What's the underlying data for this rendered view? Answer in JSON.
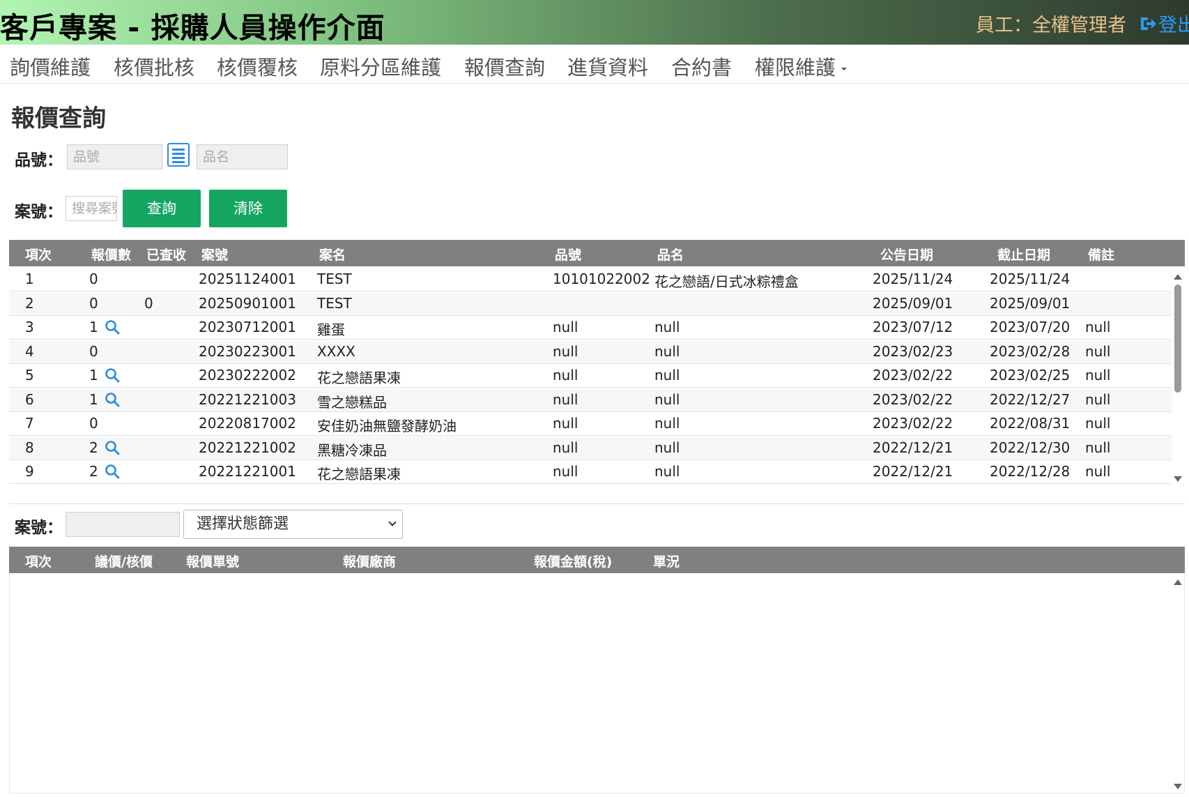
{
  "header": {
    "title": "客戶專案 - 採購人員操作介面",
    "user": "員工：全權管理者",
    "logout_label": "登出"
  },
  "nav": {
    "items": [
      "詢價維護",
      "核價批核",
      "核價覆核",
      "原料分區維護",
      "報價查詢",
      "進貨資料",
      "合約書",
      "權限維護"
    ]
  },
  "page": {
    "title": "報價查詢"
  },
  "search": {
    "part_label": "品號：",
    "part_placeholder": "品號",
    "name_placeholder": "品名",
    "case_label": "案號：",
    "case_placeholder": "搜尋案號",
    "query_button": "查詢",
    "clear_button": "清除"
  },
  "quote_table": {
    "headers": [
      "項次",
      "報價數",
      "已查收",
      "案號",
      "案名",
      "品號",
      "品名",
      "公告日期",
      "截止日期",
      "備註"
    ],
    "rows": [
      {
        "no": "1",
        "count": "0",
        "viewed": "",
        "case": "20251124001",
        "name": "TEST",
        "part": "10101022002",
        "pname": "花之戀語/日式冰粽禮盒",
        "pub": "2025/11/24",
        "due": "2025/11/24",
        "note": "",
        "search": false
      },
      {
        "no": "2",
        "count": "0",
        "viewed": "0",
        "case": "20250901001",
        "name": "TEST",
        "part": "",
        "pname": "",
        "pub": "2025/09/01",
        "due": "2025/09/01",
        "note": "",
        "search": false
      },
      {
        "no": "3",
        "count": "1",
        "viewed": "",
        "case": "20230712001",
        "name": "雞蛋",
        "part": "null",
        "pname": "null",
        "pub": "2023/07/12",
        "due": "2023/07/20",
        "note": "null",
        "search": true
      },
      {
        "no": "4",
        "count": "0",
        "viewed": "",
        "case": "20230223001",
        "name": "XXXX",
        "part": "null",
        "pname": "null",
        "pub": "2023/02/23",
        "due": "2023/02/28",
        "note": "null",
        "search": false
      },
      {
        "no": "5",
        "count": "1",
        "viewed": "",
        "case": "20230222002",
        "name": "花之戀語果凍",
        "part": "null",
        "pname": "null",
        "pub": "2023/02/22",
        "due": "2023/02/25",
        "note": "null",
        "search": true
      },
      {
        "no": "6",
        "count": "1",
        "viewed": "",
        "case": "20221221003",
        "name": "雪之戀糕品",
        "part": "null",
        "pname": "null",
        "pub": "2023/02/22",
        "due": "2022/12/27",
        "note": "null",
        "search": true
      },
      {
        "no": "7",
        "count": "0",
        "viewed": "",
        "case": "20220817002",
        "name": "安佳奶油無鹽發酵奶油",
        "part": "null",
        "pname": "null",
        "pub": "2023/02/22",
        "due": "2022/08/31",
        "note": "null",
        "search": false
      },
      {
        "no": "8",
        "count": "2",
        "viewed": "",
        "case": "20221221002",
        "name": "黑糖冷凍品",
        "part": "null",
        "pname": "null",
        "pub": "2022/12/21",
        "due": "2022/12/30",
        "note": "null",
        "search": true
      },
      {
        "no": "9",
        "count": "2",
        "viewed": "",
        "case": "20221221001",
        "name": "花之戀語果凍",
        "part": "null",
        "pname": "null",
        "pub": "2022/12/21",
        "due": "2022/12/28",
        "note": "null",
        "search": true
      }
    ]
  },
  "detail": {
    "case_label": "案號：",
    "status_select": "選擇狀態篩選",
    "headers": [
      "項次",
      "議價/核價",
      "報價單號",
      "報價廠商",
      "報價金額(稅)",
      "單況"
    ]
  },
  "colors": {
    "accent_green": "#14a561",
    "header_gray": "#808080",
    "link_blue": "#2b8be0"
  }
}
